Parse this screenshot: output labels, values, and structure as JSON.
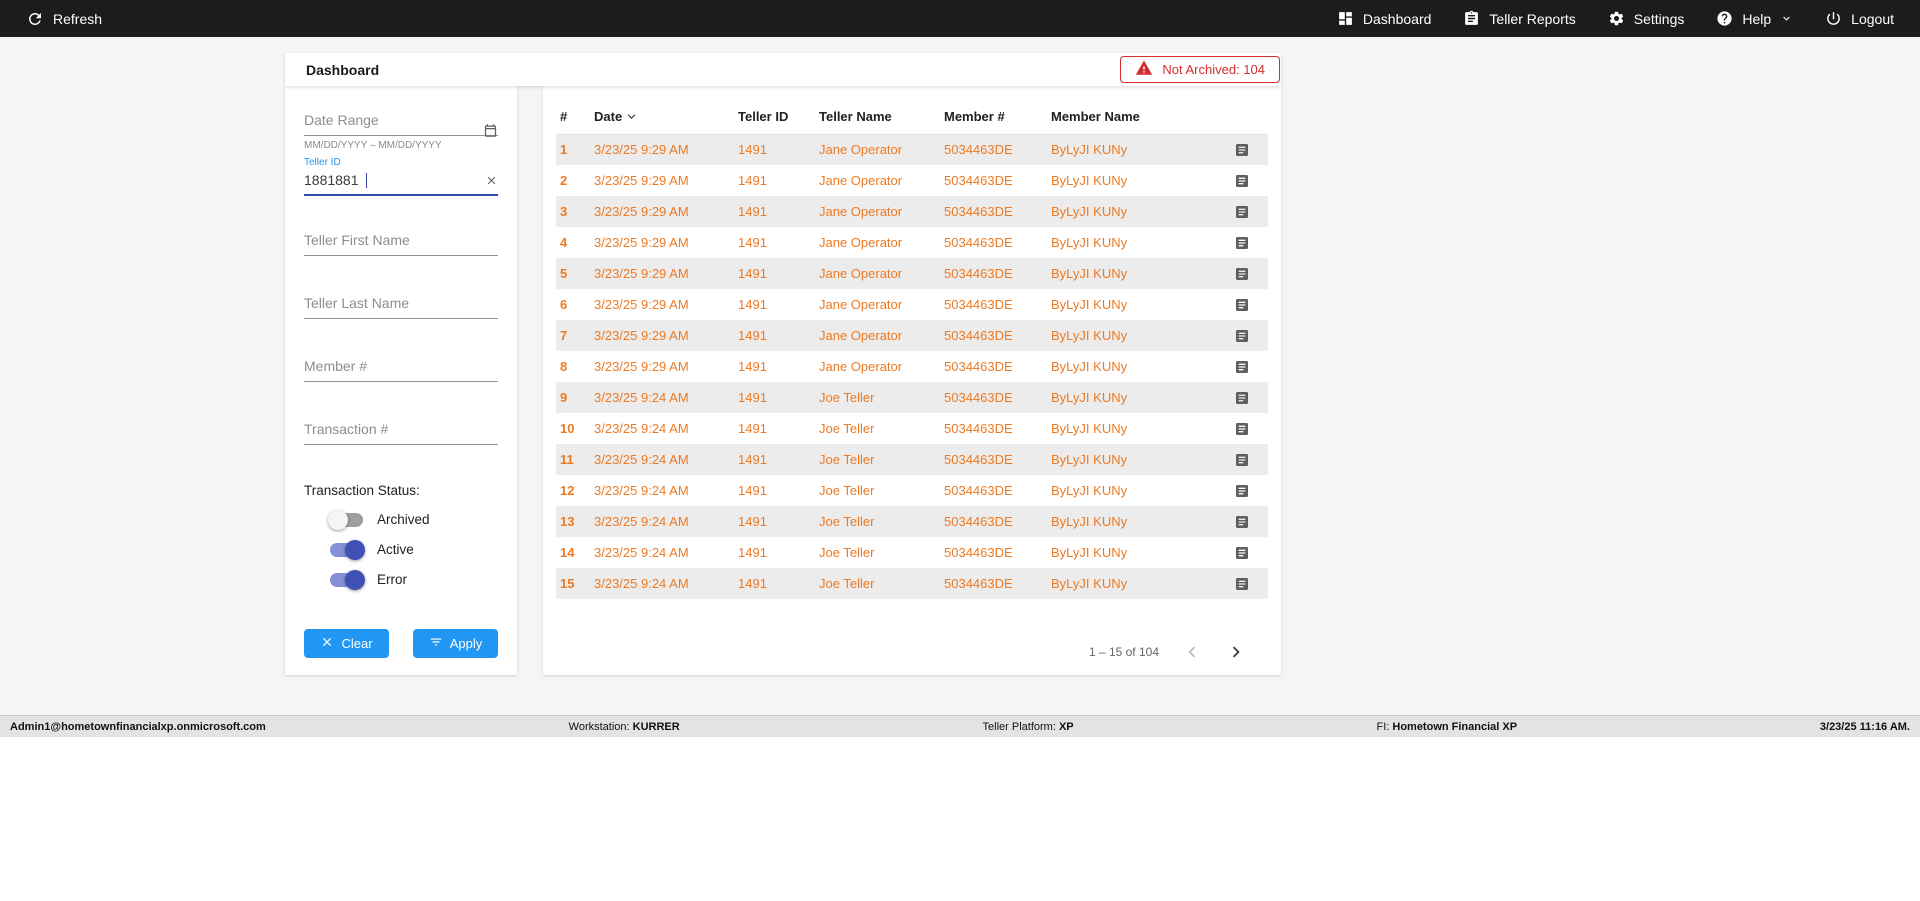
{
  "colors": {
    "accent_orange": "#ed7a23",
    "accent_blue": "#2196f3",
    "toggle_on_track": "#8591d5",
    "toggle_on_thumb": "#3f51b5",
    "badge_red": "#d32f2f",
    "topbar_bg": "#1c1c1c"
  },
  "topbar": {
    "refresh_label": "Refresh",
    "nav": [
      {
        "label": "Dashboard"
      },
      {
        "label": "Teller Reports"
      },
      {
        "label": "Settings"
      },
      {
        "label": "Help"
      },
      {
        "label": "Logout"
      }
    ]
  },
  "header": {
    "title": "Dashboard",
    "not_archived_badge": "Not Archived: 104"
  },
  "filters": {
    "date_range": {
      "placeholder": "Date Range",
      "hint": "MM/DD/YYYY – MM/DD/YYYY"
    },
    "teller_id": {
      "label": "Teller ID",
      "value": "1881881"
    },
    "teller_first_name": {
      "placeholder": "Teller First Name"
    },
    "teller_last_name": {
      "placeholder": "Teller Last Name"
    },
    "member_number": {
      "placeholder": "Member #"
    },
    "transaction_number": {
      "placeholder": "Transaction #"
    },
    "status_label": "Transaction Status:",
    "toggles": [
      {
        "label": "Archived",
        "on": false
      },
      {
        "label": "Active",
        "on": true
      },
      {
        "label": "Error",
        "on": true
      }
    ],
    "clear_label": "Clear",
    "apply_label": "Apply"
  },
  "table": {
    "columns": {
      "num": "#",
      "date": "Date",
      "teller_id": "Teller ID",
      "teller_name": "Teller Name",
      "member_num": "Member #",
      "member_name": "Member Name"
    },
    "rows": [
      {
        "num": "1",
        "date": "3/23/25 9:29 AM",
        "teller_id": "1491",
        "teller_name": "Jane Operator",
        "member_num": "5034463DE",
        "member_name": "ByLyJI KUNy"
      },
      {
        "num": "2",
        "date": "3/23/25 9:29 AM",
        "teller_id": "1491",
        "teller_name": "Jane Operator",
        "member_num": "5034463DE",
        "member_name": "ByLyJI KUNy"
      },
      {
        "num": "3",
        "date": "3/23/25 9:29 AM",
        "teller_id": "1491",
        "teller_name": "Jane Operator",
        "member_num": "5034463DE",
        "member_name": "ByLyJI KUNy"
      },
      {
        "num": "4",
        "date": "3/23/25 9:29 AM",
        "teller_id": "1491",
        "teller_name": "Jane Operator",
        "member_num": "5034463DE",
        "member_name": "ByLyJI KUNy"
      },
      {
        "num": "5",
        "date": "3/23/25 9:29 AM",
        "teller_id": "1491",
        "teller_name": "Jane Operator",
        "member_num": "5034463DE",
        "member_name": "ByLyJI KUNy"
      },
      {
        "num": "6",
        "date": "3/23/25 9:29 AM",
        "teller_id": "1491",
        "teller_name": "Jane Operator",
        "member_num": "5034463DE",
        "member_name": "ByLyJI KUNy"
      },
      {
        "num": "7",
        "date": "3/23/25 9:29 AM",
        "teller_id": "1491",
        "teller_name": "Jane Operator",
        "member_num": "5034463DE",
        "member_name": "ByLyJI KUNy"
      },
      {
        "num": "8",
        "date": "3/23/25 9:29 AM",
        "teller_id": "1491",
        "teller_name": "Jane Operator",
        "member_num": "5034463DE",
        "member_name": "ByLyJI KUNy"
      },
      {
        "num": "9",
        "date": "3/23/25 9:24 AM",
        "teller_id": "1491",
        "teller_name": "Joe Teller",
        "member_num": "5034463DE",
        "member_name": "ByLyJI KUNy"
      },
      {
        "num": "10",
        "date": "3/23/25 9:24 AM",
        "teller_id": "1491",
        "teller_name": "Joe Teller",
        "member_num": "5034463DE",
        "member_name": "ByLyJI KUNy"
      },
      {
        "num": "11",
        "date": "3/23/25 9:24 AM",
        "teller_id": "1491",
        "teller_name": "Joe Teller",
        "member_num": "5034463DE",
        "member_name": "ByLyJI KUNy"
      },
      {
        "num": "12",
        "date": "3/23/25 9:24 AM",
        "teller_id": "1491",
        "teller_name": "Joe Teller",
        "member_num": "5034463DE",
        "member_name": "ByLyJI KUNy"
      },
      {
        "num": "13",
        "date": "3/23/25 9:24 AM",
        "teller_id": "1491",
        "teller_name": "Joe Teller",
        "member_num": "5034463DE",
        "member_name": "ByLyJI KUNy"
      },
      {
        "num": "14",
        "date": "3/23/25 9:24 AM",
        "teller_id": "1491",
        "teller_name": "Joe Teller",
        "member_num": "5034463DE",
        "member_name": "ByLyJI KUNy"
      },
      {
        "num": "15",
        "date": "3/23/25 9:24 AM",
        "teller_id": "1491",
        "teller_name": "Joe Teller",
        "member_num": "5034463DE",
        "member_name": "ByLyJI KUNy"
      }
    ],
    "pagination": {
      "range_label": "1 – 15 of 104"
    }
  },
  "footer": {
    "user": "Admin1@hometownfinancialxp.onmicrosoft.com",
    "workstation_label": "Workstation:",
    "workstation_value": "KURRER",
    "platform_label": "Teller Platform:",
    "platform_value": "XP",
    "fi_label": "FI:",
    "fi_value": "Hometown Financial XP",
    "datetime": "3/23/25 11:16 AM."
  }
}
